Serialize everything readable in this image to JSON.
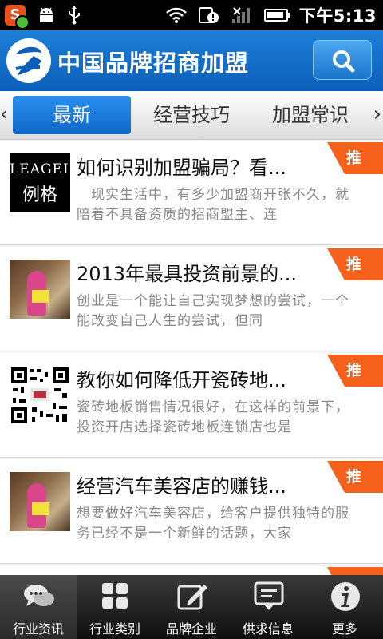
{
  "status_bar": {
    "clock": "下午5:13",
    "app_icon_letter": "S",
    "icons": [
      "app-notification-icon",
      "android-icon",
      "usb-icon",
      "wifi-icon",
      "alert-icon",
      "signal-icon",
      "battery-icon"
    ]
  },
  "header": {
    "title": "中国品牌招商加盟",
    "logo_icon": "brand-logo-icon",
    "search_icon": "search-icon"
  },
  "tabs": {
    "items": [
      {
        "label": "最新",
        "active": true
      },
      {
        "label": "经营技巧",
        "active": false
      },
      {
        "label": "加盟常识",
        "active": false
      }
    ],
    "prev_icon": "chevron-left-icon",
    "next_icon": "chevron-right-icon"
  },
  "articles": [
    {
      "title": "如何识别加盟骗局？看...",
      "summary": "　现实生活中，有多少加盟商开张不久，就陪着不具备资质的招商盟主、连",
      "badge": "推",
      "thumb_text": {
        "en": "LEAGEL",
        "zh": "例格"
      }
    },
    {
      "title": "2013年最具投资前景的...",
      "summary": "创业是一个能让自己实现梦想的尝试，一个能改变自己人生的尝试，但同",
      "badge": "推"
    },
    {
      "title": "教你如何降低开瓷砖地...",
      "summary": "瓷砖地板销售情况很好，在这样的前景下，投资开店选择瓷砖地板连锁店也是",
      "badge": "推"
    },
    {
      "title": "经营汽车美容店的赚钱...",
      "summary": "想要做好汽车美容店，给客户提供独特的服务已经不是一个新鲜的话题，大家",
      "badge": "推"
    }
  ],
  "bottom_nav": [
    {
      "label": "行业资讯",
      "icon": "chat-bubbles-icon",
      "active": true
    },
    {
      "label": "行业类别",
      "icon": "grid-icon",
      "active": false
    },
    {
      "label": "品牌企业",
      "icon": "edit-icon",
      "active": false
    },
    {
      "label": "供求信息",
      "icon": "message-icon",
      "active": false
    },
    {
      "label": "更多",
      "icon": "info-icon",
      "active": false
    }
  ],
  "colors": {
    "header_blue": "#0b5fb8",
    "badge_orange": "#f5601a",
    "active_tab_blue": "#1a7ce0"
  }
}
